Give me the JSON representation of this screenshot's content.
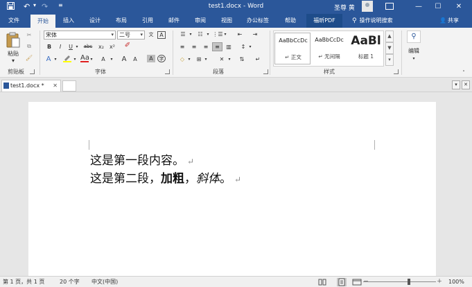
{
  "window": {
    "title": "test1.docx - Word",
    "user": "圣尊 黄",
    "controls": [
      "minimize-icon",
      "restore-icon",
      "close-icon"
    ]
  },
  "tabs": [
    "文件",
    "开始",
    "插入",
    "设计",
    "布局",
    "引用",
    "邮件",
    "审阅",
    "视图",
    "办公标签",
    "帮助",
    "福昕PDF"
  ],
  "active_tab": "开始",
  "tell_me": "操作说明搜索",
  "share": "共享",
  "ribbon": {
    "clipboard": {
      "paste": "粘贴",
      "label": "剪贴板"
    },
    "font": {
      "font_name": "宋体",
      "font_size": "二号",
      "label": "字体",
      "buttons": [
        "B",
        "I",
        "U",
        "abc",
        "x₂",
        "x²",
        "A",
        "Aa",
        "A",
        "A",
        "A"
      ]
    },
    "paragraph": {
      "label": "段落"
    },
    "styles": {
      "label": "样式",
      "items": [
        {
          "sample": "AaBbCcDc",
          "name": "正文"
        },
        {
          "sample": "AaBbCcDc",
          "name": "无间隔"
        },
        {
          "sample": "AaBl",
          "name": "标题 1"
        }
      ]
    },
    "editing": {
      "label": "编辑"
    }
  },
  "document_tab": {
    "name": "test1.docx *"
  },
  "document": {
    "paragraph1": "这是第一段内容。",
    "paragraph2_plain": "这是第二段，",
    "paragraph2_bold": "加粗",
    "paragraph2_mid": "，",
    "paragraph2_italic": "斜体",
    "paragraph2_end": "。",
    "paragraph_mark": "↵"
  },
  "status": {
    "page": "第 1 页，共 1 页",
    "words": "20 个字",
    "language": "中文(中国)",
    "zoom": "100%",
    "zoom_minus": "－",
    "zoom_plus": "＋"
  }
}
